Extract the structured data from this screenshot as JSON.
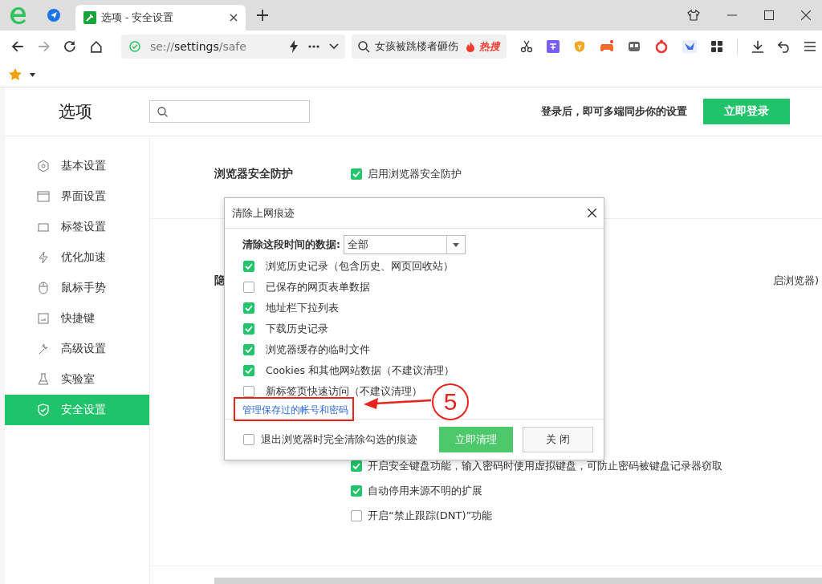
{
  "browser": {
    "tabs": [
      {
        "title": "选项 - 安全设置",
        "selected": true
      }
    ],
    "address": "se://**settings**/safe",
    "search_hint": "女孩被跳楼者砸伤",
    "hot_badge": "热搜"
  },
  "header": {
    "title": "选项",
    "sync_text": "登录后，即可多端同步你的设置",
    "login_button": "立即登录"
  },
  "sidebar": {
    "items": [
      {
        "label": "基本设置",
        "selected": false
      },
      {
        "label": "界面设置",
        "selected": false
      },
      {
        "label": "标签设置",
        "selected": false
      },
      {
        "label": "优化加速",
        "selected": false
      },
      {
        "label": "鼠标手势",
        "selected": false
      },
      {
        "label": "快捷键",
        "selected": false
      },
      {
        "label": "高级设置",
        "selected": false
      },
      {
        "label": "实验室",
        "selected": false
      },
      {
        "label": "安全设置",
        "selected": true
      }
    ]
  },
  "sections": [
    {
      "title": "浏览器安全防护",
      "option": {
        "label": "启用浏览器安全防护",
        "checked": true
      }
    },
    {
      "title": "隐",
      "side_text": "启浏览器)",
      "options": [
        {
          "label": "开启安全键盘功能，输入密码时使用虚拟键盘，可防止密码被键盘记录器窃取",
          "checked": true
        },
        {
          "label": "自动停用来源不明的扩展",
          "checked": true
        },
        {
          "label": "开启“禁止跟踪(DNT)”功能",
          "checked": false
        }
      ]
    }
  ],
  "dialog": {
    "title": "清除上网痕迹",
    "range_label": "清除这段时间的数据:",
    "range_value": "全部",
    "items": [
      {
        "label": "浏览历史记录（包含历史、网页回收站）",
        "checked": true
      },
      {
        "label": "已保存的网页表单数据",
        "checked": false
      },
      {
        "label": "地址栏下拉列表",
        "checked": true
      },
      {
        "label": "下载历史记录",
        "checked": true
      },
      {
        "label": "浏览器缓存的临时文件",
        "checked": true
      },
      {
        "label": "Cookies 和其他网站数据（不建议清理）",
        "checked": true
      },
      {
        "label": "新标签页快速访问（不建议清理）",
        "checked": false
      }
    ],
    "link": "管理保存过的帐号和密码",
    "exit_option": {
      "label": "退出浏览器时完全清除勾选的痕迹",
      "checked": false
    },
    "buttons": [
      "立即清理",
      "关 闭"
    ]
  },
  "annotation": {
    "label": "5"
  }
}
